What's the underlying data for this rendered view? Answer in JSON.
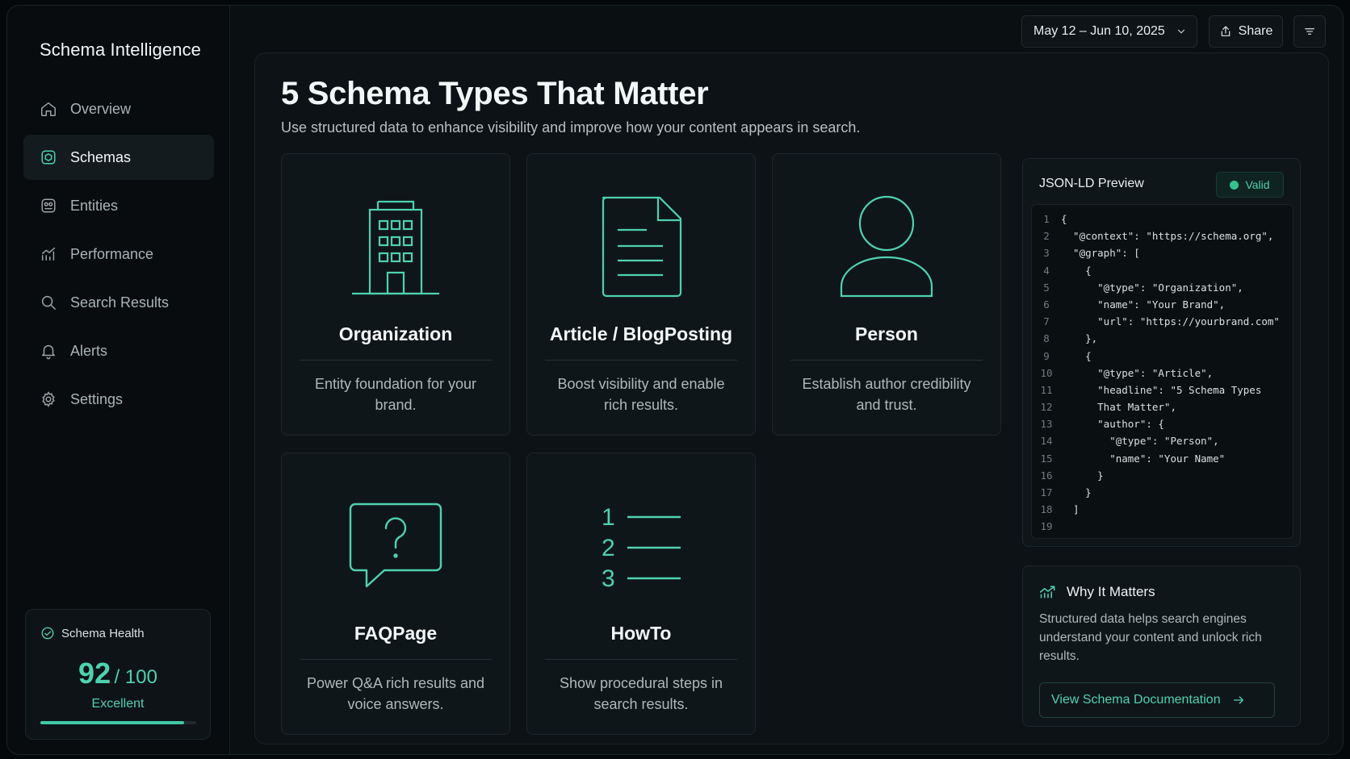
{
  "app": {
    "brand": "Schema Intelligence",
    "accent_color": "#4fd1b0"
  },
  "sidebar": {
    "items": [
      {
        "label": "Overview",
        "icon": "home-icon",
        "active": false
      },
      {
        "label": "Schemas",
        "icon": "schema-icon",
        "active": true
      },
      {
        "label": "Entities",
        "icon": "entities-icon",
        "active": false
      },
      {
        "label": "Performance",
        "icon": "chart-icon",
        "active": false
      },
      {
        "label": "Search Results",
        "icon": "search-icon",
        "active": false
      },
      {
        "label": "Alerts",
        "icon": "bell-icon",
        "active": false
      },
      {
        "label": "Settings",
        "icon": "gear-icon",
        "active": false
      }
    ],
    "health": {
      "title": "Schema Health",
      "score": "92",
      "max": "/ 100",
      "label": "Excellent",
      "progress_fraction": 0.92
    }
  },
  "toolbar": {
    "date_range": "May 12 – Jun 10, 2025",
    "share_label": "Share"
  },
  "main": {
    "title": "5 Schema Types That Matter",
    "subtitle": "Use structured data to enhance visibility and improve how your content appears in search.",
    "cards": [
      {
        "name": "Organization",
        "icon": "building-icon",
        "description": "Entity foundation for your brand."
      },
      {
        "name": "Article / BlogPosting",
        "icon": "document-icon",
        "description": "Boost visibility and enable rich results."
      },
      {
        "name": "Person",
        "icon": "person-icon",
        "description": "Establish author credibility and trust."
      },
      {
        "name": "FAQPage",
        "icon": "question-bubble-icon",
        "description": "Power Q&A rich results and voice answers."
      },
      {
        "name": "HowTo",
        "icon": "numbered-list-icon",
        "description": "Show procedural steps in search results."
      }
    ]
  },
  "json_preview": {
    "title": "JSON-LD Preview",
    "status": "Valid",
    "lines": [
      "{",
      "  \"@context\": \"https://schema.org\",",
      "  \"@graph\": [",
      "    {",
      "      \"@type\": \"Organization\",",
      "      \"name\": \"Your Brand\",",
      "      \"url\": \"https://yourbrand.com\"",
      "    },",
      "    {",
      "      \"@type\": \"Article\",",
      "      \"headline\": \"5 Schema Types",
      "      That Matter\",",
      "      \"author\": {",
      "        \"@type\": \"Person\",",
      "        \"name\": \"Your Name\"",
      "      }",
      "    }",
      "  ]",
      ""
    ]
  },
  "why": {
    "title": "Why It Matters",
    "text": "Structured data helps search engines understand your content and unlock rich results.",
    "button_label": "View Schema Documentation"
  }
}
